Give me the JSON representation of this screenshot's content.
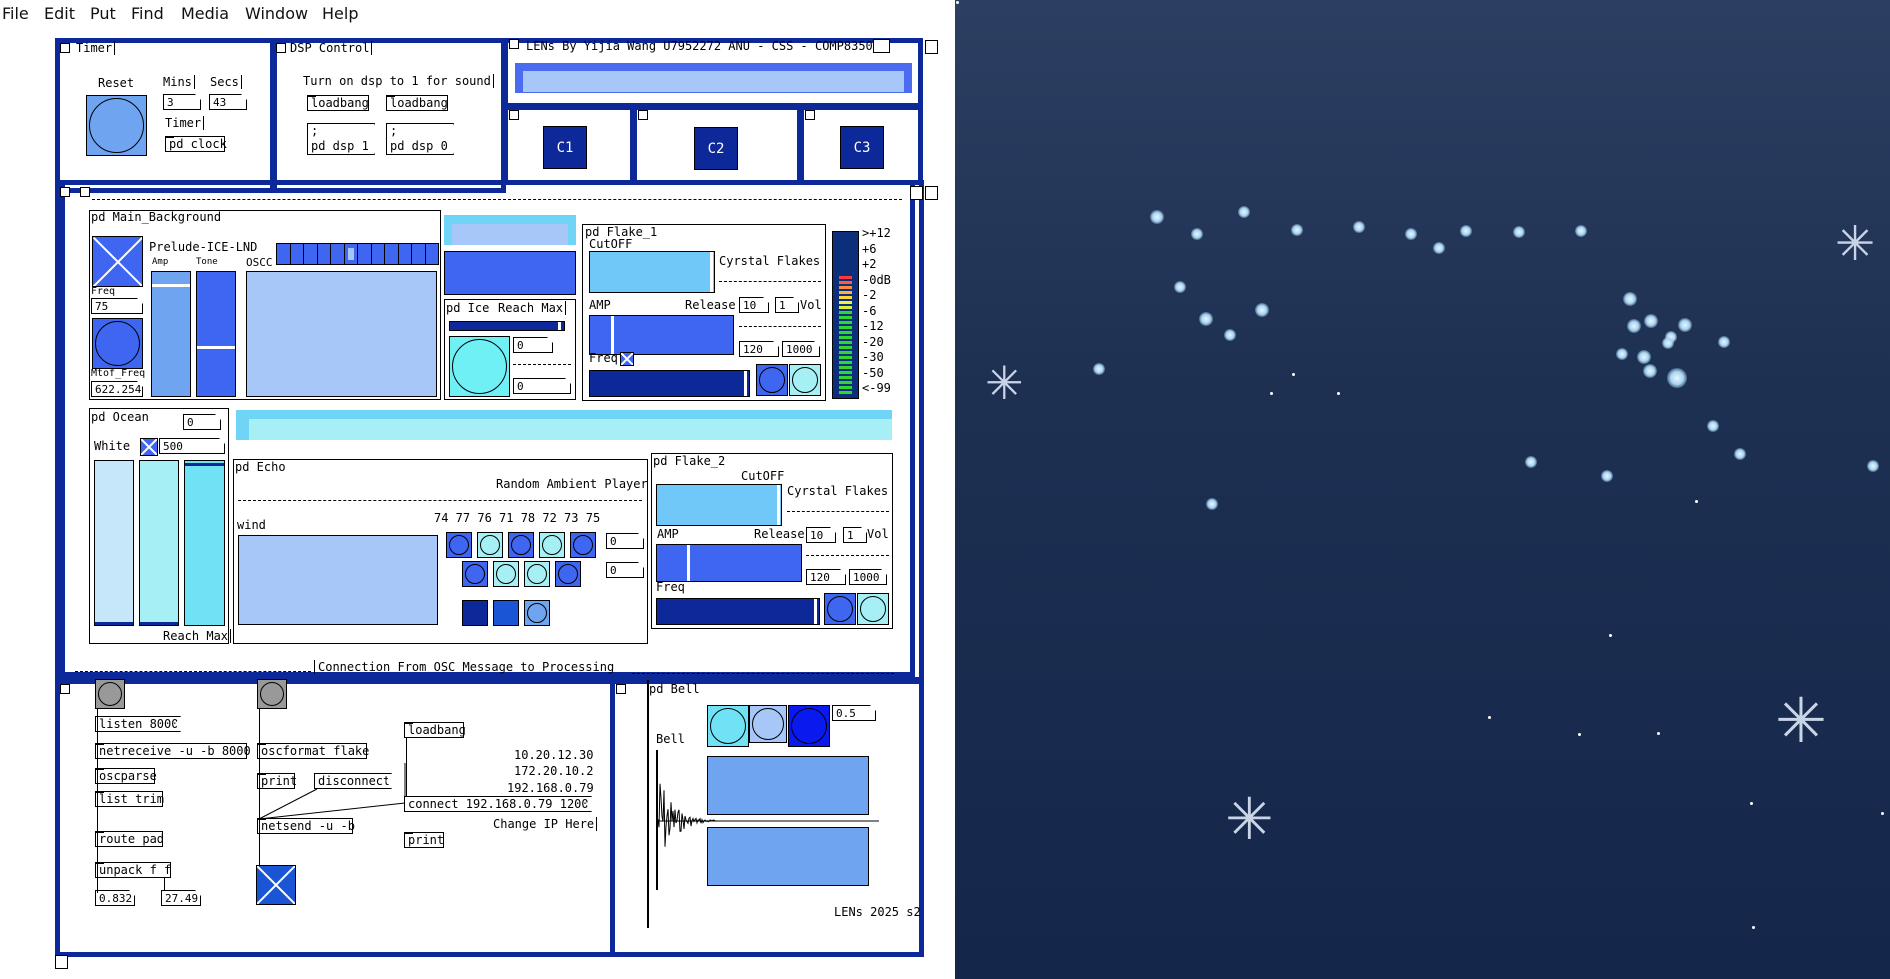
{
  "menu": [
    "File",
    "Edit",
    "Put",
    "Find",
    "Media",
    "Window",
    "Help"
  ],
  "colors": {
    "frame": "#0d2899",
    "light_blue": "#6ea4f0",
    "pale_blue": "#a6c7f7",
    "cyan": "#6fe3f5",
    "deep_blue": "#0a1a8a",
    "mid_blue": "#3f66f0",
    "sky_top": "#2c3f62",
    "sky_bottom": "#14264a"
  },
  "timer": {
    "title": "Timer",
    "reset": "Reset",
    "mins": "Mins",
    "secs": "Secs",
    "mins_value": "3",
    "secs_value": "43",
    "timer_label": "Timer",
    "clock": "pd clock"
  },
  "dsp": {
    "title": "DSP Control",
    "note": "Turn on dsp to 1 for sound",
    "loadbang1": "loadbang",
    "loadbang2": "loadbang",
    "dsp1_a": ";",
    "dsp1_b": "pd dsp 1",
    "dsp0_a": ";",
    "dsp0_b": "pd dsp 0"
  },
  "lens_title": "LENs By Yijia Wang U7952272 ANU - CSS - COMP8350",
  "scenes": {
    "c1": "C1",
    "c2": "C2",
    "c3": "C3"
  },
  "main_bg": {
    "title": "pd Main_Background",
    "prelude": "Prelude-ICE-LND",
    "amp": "Amp",
    "tone": "Tone",
    "oscc": "OSCC",
    "freq": "Freq",
    "freq_value": "75",
    "mtof": "Mtof_Freq",
    "mtof_value": "622.254",
    "radio_active_index": 5,
    "radio_count": 12,
    "amp_level": 0.9,
    "tone_level": 0.4
  },
  "ice": {
    "title": "pd Ice",
    "reach": "Reach Max",
    "n1": "0",
    "n2": "0",
    "bar_level": 0.97
  },
  "flake1": {
    "title": "pd Flake_1",
    "cutoff": "CutOFF",
    "crystal": "Cyrstal Flakes",
    "amp": "AMP",
    "release": "Release",
    "release_value": "10",
    "vol_value": "1",
    "vol": "Vol",
    "freq": "Freq",
    "n120": "120",
    "n1000": "1000",
    "cutoff_level": 0.99,
    "amp_level": 0.17
  },
  "vu": {
    "labels": [
      ">+12",
      "+6",
      "+2",
      "-0dB",
      "-2",
      "-6",
      "-12",
      "-20",
      "-30",
      "-50",
      "<-99"
    ]
  },
  "ocean": {
    "title": "pd Ocean",
    "value": "0",
    "white": "White",
    "white_value": "500",
    "reach": "Reach Max",
    "levels": [
      0.02,
      0.02,
      0.97
    ]
  },
  "echo": {
    "title": "pd Echo",
    "random": "Random Ambient Player",
    "wind": "wind",
    "notes": "74 77 76 71 78 72 73 75",
    "n1": "0",
    "n2": "0"
  },
  "flake2": {
    "title": "pd Flake_2",
    "cutoff": "CutOFF",
    "crystal": "Cyrstal Flakes",
    "amp": "AMP",
    "release": "Release",
    "release_value": "10",
    "vol_value": "1",
    "vol": "Vol",
    "freq": "Freq",
    "n120": "120",
    "n1000": "1000",
    "cutoff_level": 0.99,
    "amp_level": 0.23
  },
  "osc": {
    "title": "Connection From OSC Message to Processing",
    "listen": "listen 8000",
    "netreceive": "netreceive -u -b 8000",
    "oscparse": "oscparse",
    "listtrim": "list trim",
    "routepad": "route pad",
    "unpack": "unpack f f",
    "v1": "0.832",
    "v2": "27.49",
    "oscformat": "oscformat flake",
    "print1": "print",
    "disconnect": "disconnect",
    "netsend": "netsend -u -b",
    "loadbang": "loadbang",
    "ip1": "10.20.12.30",
    "ip2": "172.20.10.2",
    "ip3": "192.168.0.79",
    "connect": "connect 192.168.0.79 12000",
    "changeip": "Change IP Here",
    "print2": "print"
  },
  "bell": {
    "title": "pd Bell",
    "value": "0.5",
    "bell": "Bell"
  },
  "footer": "LENs 2025 s2"
}
